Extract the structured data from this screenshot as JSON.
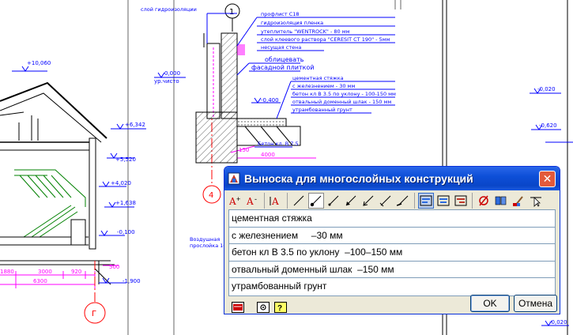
{
  "drawing": {
    "level_labels": [
      "+10,060",
      "+6,342",
      "+5,520",
      "+4,020",
      "+1,638",
      "-0,100",
      "-1,900",
      "0,000",
      "-0,400",
      "-0,020",
      "-0,620",
      "-0,020"
    ],
    "dimension_labels": [
      "1880",
      "3000",
      "920",
      "6300",
      "500",
      "4000",
      "150"
    ],
    "axis_marks": [
      "1",
      "4",
      "Г"
    ],
    "ur_chista": "ур.чисто",
    "wall_layers": [
      "профлист С18",
      "гидроизоляция пленка",
      "утеплитель \"WENTROCK\" - 80 мм",
      "слой клеевого раствора \"CERESIT CT 190\" - 5мм",
      "несущая стена"
    ],
    "waterproof_label": "слой гидроизоляции",
    "facade_label_1": "облицевать",
    "facade_label_2": "фасадной плиткой",
    "floor_layers": [
      "цементная стяжка",
      "с железнением - 30 мм",
      "бетон кл В 3.5 по уклону - 100-150 мм",
      "отвальный доменный шлак - 150 мм",
      "утрамбованный грунт"
    ],
    "concrete_label": "Бетон кл. В 7.5",
    "left_note_1": "Воздушная",
    "left_note_2": "прослойка 10"
  },
  "dialog": {
    "title": "Выноска для многослойных конструкций",
    "close_icon": "close-icon",
    "lines": [
      "цементная стяжка",
      "с железнением     –30 мм",
      "бетон кл В 3.5 по уклону  –100–150 мм",
      "отвальный доменный шлак  –150 мм",
      "утрамбованный грунт"
    ],
    "ok_label": "OK",
    "cancel_label": "Отмена"
  },
  "colors": {
    "cad_blue": "#0000ff",
    "cad_magenta": "#ff00ff",
    "cad_red": "#ff0000",
    "title_blue": "#0a46c8",
    "green": "#008000"
  }
}
